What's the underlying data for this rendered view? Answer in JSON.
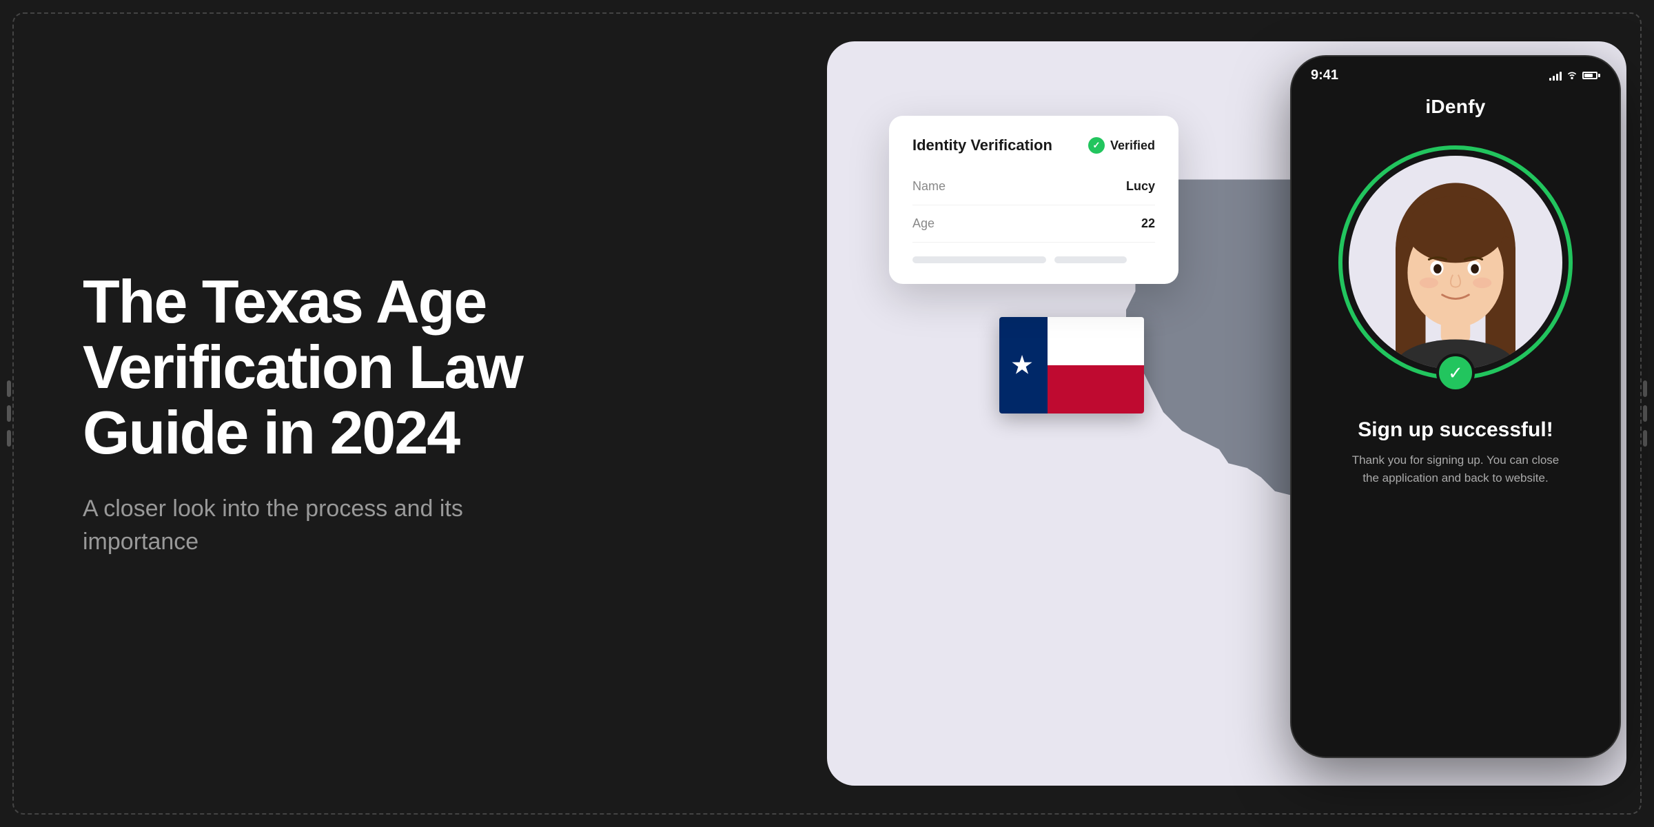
{
  "background": {
    "color": "#1a1a1a"
  },
  "left": {
    "title": "The Texas Age Verification Law Guide in 2024",
    "subtitle": "A closer look into the process and its importance"
  },
  "id_card": {
    "title": "Identity Verification",
    "verified_label": "Verified",
    "rows": [
      {
        "label": "Name",
        "value": "Lucy"
      },
      {
        "label": "Age",
        "value": "22"
      }
    ]
  },
  "phone": {
    "status_bar": {
      "time": "9:41",
      "app_name": "iDenfy"
    },
    "signup": {
      "title": "Sign up successful!",
      "description": "Thank you for signing up. You can close the application and back to website."
    }
  },
  "colors": {
    "green": "#22c55e",
    "bg_card": "#e8e6f0",
    "phone_bg": "#141414",
    "white": "#ffffff",
    "text_dark": "#1a1a1a",
    "text_gray": "#888888",
    "text_light": "#aaaaaa"
  }
}
